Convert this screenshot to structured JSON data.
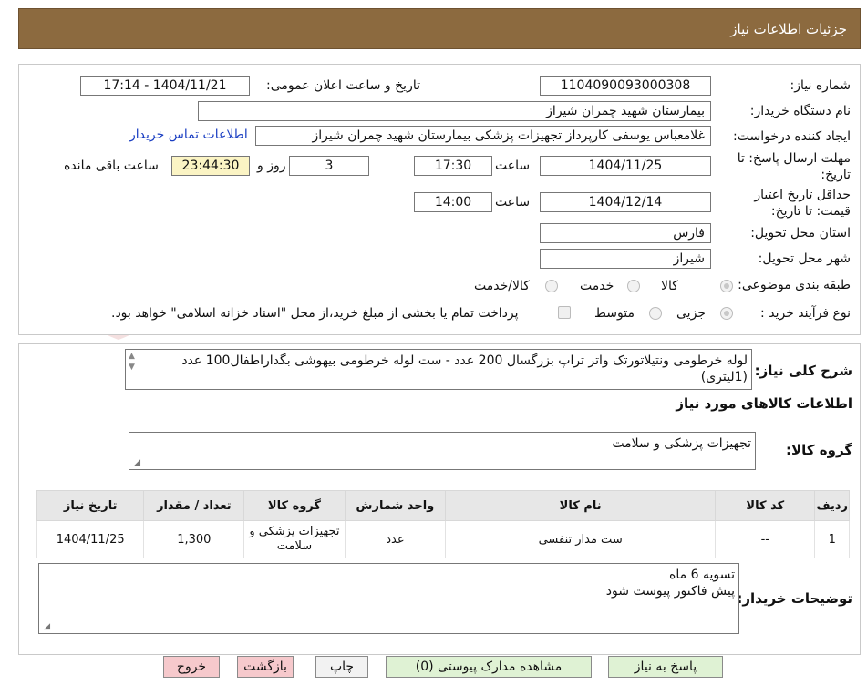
{
  "header": {
    "title": "جزئیات اطلاعات نیاز"
  },
  "details": {
    "need_number_label": "شماره نیاز:",
    "need_number": "1104090093000308",
    "announce_label": "تاریخ و ساعت اعلان عمومی:",
    "announce_value": "1404/11/21 - 17:14",
    "buyer_org_label": "نام دستگاه خریدار:",
    "buyer_org": "بیمارستان شهید چمران شیراز",
    "requester_label": "ایجاد کننده درخواست:",
    "requester": "غلامعباس  یوسفی کارپرداز تجهیزات پزشکی بیمارستان شهید چمران شیراز",
    "contact_link": "اطلاعات تماس خریدار",
    "deadline_label_1": "مهلت ارسال پاسخ: تا",
    "deadline_label_2": "تاریخ:",
    "deadline_date": "1404/11/25",
    "time_label": "ساعت",
    "deadline_time": "17:30",
    "days_value": "3",
    "days_label": "روز و",
    "remaining_time": "23:44:30",
    "remaining_label": "ساعت باقی مانده",
    "validity_label_1": "حداقل تاریخ اعتبار",
    "validity_label_2": "قیمت: تا تاریخ:",
    "validity_date": "1404/12/14",
    "validity_time": "14:00",
    "province_label": "استان محل تحویل:",
    "province": "فارس",
    "city_label": "شهر محل تحویل:",
    "city": "شیراز",
    "category_label": "طبقه بندی موضوعی:",
    "category_options": [
      "کالا",
      "خدمت",
      "کالا/خدمت"
    ],
    "process_label": "نوع فرآیند خرید :",
    "process_options": [
      "جزیی",
      "متوسط"
    ],
    "treasury_note": "پرداخت تمام یا بخشی از مبلغ خرید،از محل \"اسناد خزانه اسلامی\" خواهد بود."
  },
  "summary": {
    "label": "شرح کلی نیاز:",
    "text": "لوله خرطومی ونتیلاتورتک واتر تراپ بزرگسال 200 عدد - ست لوله خرطومی بیهوشی بگداراطفال100 عدد (1لیتری)",
    "goods_info_title": "اطلاعات کالاهای مورد نیاز",
    "goods_group_label": "گروه کالا:",
    "goods_group": "تجهیزات پزشکی و سلامت"
  },
  "table": {
    "headers": [
      "ردیف",
      "کد کالا",
      "نام کالا",
      "واحد شمارش",
      "گروه کالا",
      "تعداد / مقدار",
      "تاریخ نیاز"
    ],
    "rows": [
      [
        "1",
        "--",
        "ست مدار تنفسی",
        "عدد",
        "تجهیزات پزشکی و سلامت",
        "1,300",
        "1404/11/25"
      ]
    ]
  },
  "buyer_notes": {
    "label": "توضیحات خریدار:",
    "line1": "تسویه 6 ماه",
    "line2": "پیش فاکتور پیوست شود"
  },
  "buttons": {
    "reply": "پاسخ به نیاز",
    "attachments": "مشاهده مدارک پیوستی (0)",
    "print": "چاپ",
    "back": "بازگشت",
    "exit": "خروج"
  },
  "watermark": {
    "text": "AriaTender.neT"
  },
  "colors": {
    "header_bg": "#8c6a3f",
    "green_button": "#dff2d4",
    "pink_button": "#f6c9cc",
    "link": "#1a3ec2",
    "remaining_bg": "#fbf4c4"
  }
}
